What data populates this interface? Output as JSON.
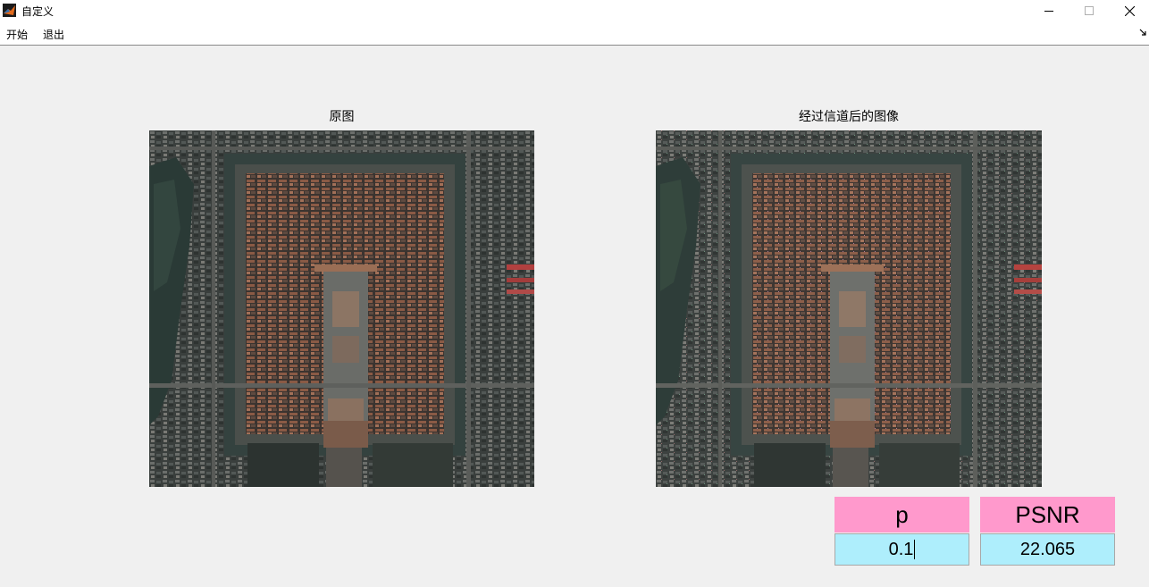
{
  "window": {
    "title": "自定义",
    "icons": {
      "app": "matlab-icon",
      "minimize": "minimize-icon",
      "maximize": "maximize-icon",
      "close": "close-icon"
    }
  },
  "menu": {
    "items": [
      {
        "label": "开始"
      },
      {
        "label": "退出"
      }
    ],
    "dock_icon": "undock-arrow-icon"
  },
  "axes": [
    {
      "title": "原图",
      "image_desc": "aerial-forbidden-city"
    },
    {
      "title": "经过信道后的图像",
      "image_desc": "aerial-forbidden-city-noisy"
    }
  ],
  "controls": {
    "p": {
      "label": "p",
      "value": "0.1"
    },
    "psnr": {
      "label": "PSNR",
      "value": "22.065"
    }
  },
  "colors": {
    "label_bg": "#ff99cc",
    "value_bg": "#aeeefc",
    "background": "#f0f0f0"
  }
}
